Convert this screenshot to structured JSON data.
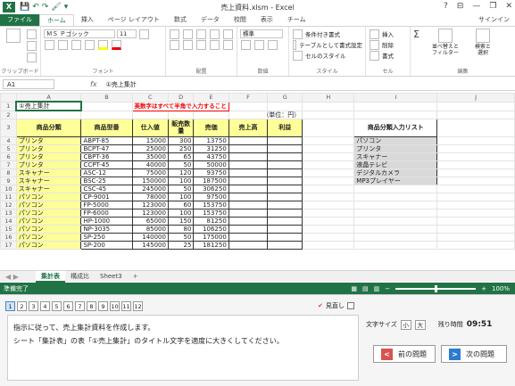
{
  "window": {
    "title": "売上資料.xlsm - Excel",
    "help": "?",
    "ribbon_display": "⊟",
    "minimize": "—",
    "restore": "❐",
    "close": "✕",
    "signin": "サインイン"
  },
  "qat": [
    "💾",
    "↶",
    "↷",
    "🖌",
    "▾"
  ],
  "tabs": [
    "ファイル",
    "ホーム",
    "挿入",
    "ページ レイアウト",
    "数式",
    "データ",
    "校閲",
    "表示",
    "チーム"
  ],
  "ribbon": {
    "clipboard_label": "クリップボード",
    "font_label": "フォント",
    "font_name": "ＭＳ Ｐゴシック",
    "font_size": "11",
    "align_label": "配置",
    "number_label": "数値",
    "number_format": "標準",
    "styles_label": "スタイル",
    "cond_format": "条件付き書式",
    "table_format": "テーブルとして書式設定",
    "cell_style": "セルのスタイル",
    "cells_label": "セル",
    "insert": "挿入",
    "delete": "削除",
    "format": "書式",
    "edit_label": "編集",
    "sort_filter": "並べ替えと\nフィルター",
    "find_select": "検索と\n選択",
    "sum_icon": "Σ"
  },
  "formula_bar": {
    "name_box": "A1",
    "fx": "fx",
    "content": "①売上集計"
  },
  "columns": [
    "A",
    "B",
    "C",
    "D",
    "E",
    "F",
    "G",
    "H",
    "I",
    "J"
  ],
  "sheet": {
    "a1": "①売上集計",
    "note": "英数字はすべて半角で入力すること",
    "unit": "（単位：円）",
    "headers": [
      "商品分類",
      "商品型番",
      "仕入値",
      "販売数量",
      "売価",
      "売上高",
      "利益"
    ],
    "rows": [
      [
        "プリンタ",
        "ABPT-85",
        "15000",
        "300",
        "13750"
      ],
      [
        "プリンタ",
        "BCPT-47",
        "25000",
        "250",
        "31250"
      ],
      [
        "プリンタ",
        "CBPT-36",
        "35000",
        "65",
        "43750"
      ],
      [
        "プリンタ",
        "CCPT-45",
        "40000",
        "50",
        "50000"
      ],
      [
        "スキャナー",
        "ASC-12",
        "75000",
        "120",
        "93750"
      ],
      [
        "スキャナー",
        "BSC-25",
        "150000",
        "100",
        "187500"
      ],
      [
        "スキャナー",
        "CSC-45",
        "245000",
        "50",
        "306250"
      ],
      [
        "パソコン",
        "CP-9001",
        "78000",
        "100",
        "97500"
      ],
      [
        "パソコン",
        "FP-5000",
        "123000",
        "60",
        "153750"
      ],
      [
        "パソコン",
        "FP-6000",
        "123000",
        "100",
        "153750"
      ],
      [
        "パソコン",
        "HP-1000",
        "65000",
        "150",
        "81250"
      ],
      [
        "パソコン",
        "NP-3035",
        "85000",
        "80",
        "106250"
      ],
      [
        "パソコン",
        "SP-250",
        "140000",
        "50",
        "175000"
      ],
      [
        "パソコン",
        "SP-200",
        "145000",
        "25",
        "181250"
      ]
    ],
    "row_numbers": [
      "1",
      "2",
      "3",
      "4",
      "5",
      "6",
      "7",
      "8",
      "9",
      "10",
      "11",
      "12",
      "13",
      "14",
      "15",
      "16",
      "17"
    ],
    "list_title": "商品分類入力リスト",
    "list_items": [
      "パソコン",
      "プリンタ",
      "スキャナー",
      "液晶テレビ",
      "デジタルカメラ",
      "MP3プレイヤー"
    ]
  },
  "sheet_tabs": [
    "集計表",
    "構成比",
    "Sheet3"
  ],
  "add_sheet": "+",
  "status": {
    "ready": "準備完了",
    "zoom": "100%"
  },
  "panel": {
    "question_numbers": [
      "1",
      "2",
      "3",
      "4",
      "5",
      "6",
      "7",
      "8",
      "9",
      "10",
      "11",
      "12"
    ],
    "mitoshi": "見直し",
    "question_line1": "指示に従って、売上集計資料を作成します。",
    "question_line2": "シート「集計表」の表「①売上集計」のタイトル文字を適度に大きくしてください。",
    "font_size_label": "文字サイズ",
    "small": "小",
    "large": "大",
    "remaining_label": "残り時間",
    "remaining_time": "09:51",
    "prev_button": "前の問題",
    "next_button": "次の問題"
  },
  "colors": {
    "excel_green": "#217346",
    "category_fill": "#ffff99",
    "list_fill": "#d9d9d9",
    "note_red": "#ee0000"
  }
}
